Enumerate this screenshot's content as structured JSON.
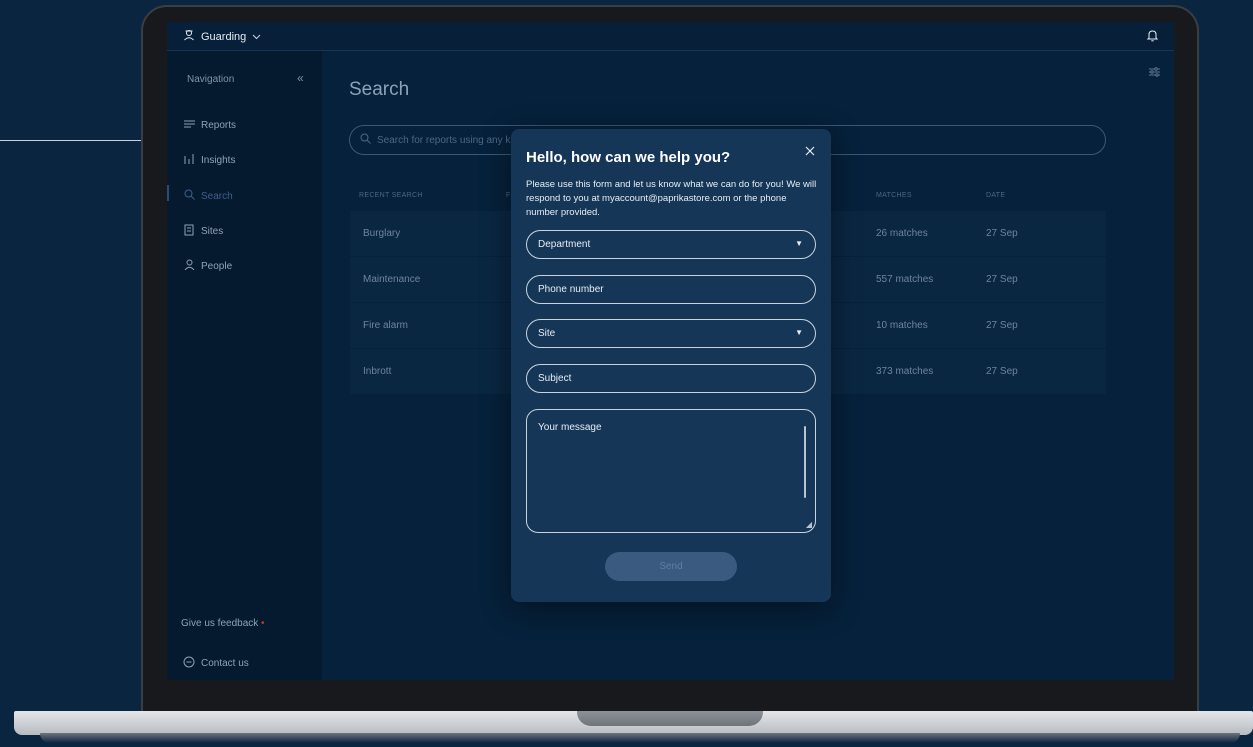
{
  "topbar": {
    "app_name": "Guarding"
  },
  "sidebar": {
    "title": "Navigation",
    "items": [
      {
        "label": "Reports",
        "icon": "lines-icon"
      },
      {
        "label": "Insights",
        "icon": "bars-icon"
      },
      {
        "label": "Search",
        "icon": "search-icon",
        "active": true
      },
      {
        "label": "Sites",
        "icon": "building-icon"
      },
      {
        "label": "People",
        "icon": "person-icon"
      }
    ],
    "feedback": "Give us feedback",
    "feedback_marker": "•",
    "contact": "Contact us"
  },
  "main": {
    "title": "Search",
    "search_placeholder": "Search for reports using any k",
    "columns": {
      "recent": "RECENT SEARCH",
      "col2": "F",
      "matches": "MATCHES",
      "date": "DATE"
    },
    "rows": [
      {
        "term": "Burglary",
        "matches": "26 matches",
        "date": "27 Sep"
      },
      {
        "term": "Maintenance",
        "matches": "557 matches",
        "date": "27 Sep"
      },
      {
        "term": "Fire alarm",
        "matches": "10 matches",
        "date": "27 Sep"
      },
      {
        "term": "Inbrott",
        "matches": "373 matches",
        "date": "27 Sep"
      }
    ]
  },
  "modal": {
    "title": "Hello, how can we help you?",
    "description": "Please use this form and let us know what we can do for you! We will respond to you at myaccount@paprikastore.com or the phone number provided.",
    "department": "Department",
    "phone": "Phone number",
    "site": "Site",
    "subject": "Subject",
    "message": "Your message",
    "send": "Send"
  },
  "colors": {
    "background": "#0a2540",
    "modal": "#163657",
    "accent": "#3a5a80",
    "feedback_dot": "#c0392b"
  }
}
